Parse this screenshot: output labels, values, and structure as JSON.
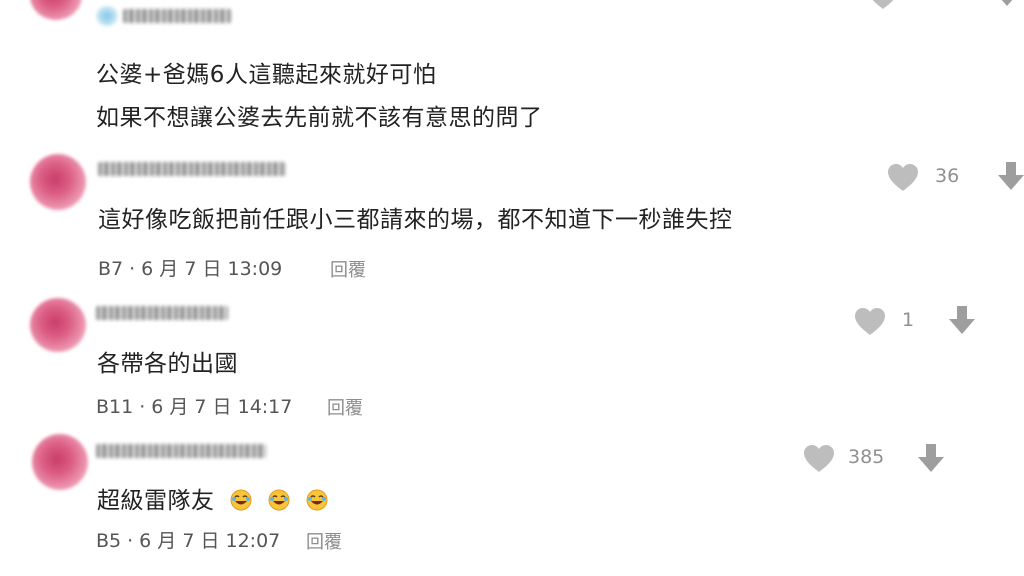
{
  "comments": [
    {
      "lines": [
        "公婆+爸媽6人這聽起來就好可怕",
        "如果不想讓公婆去先前就不該有意思的問了"
      ]
    },
    {
      "text": "這好像吃飯把前任跟小三都請來的場，都不知道下一秒誰失控",
      "floor": "B7",
      "date": "6 月 7 日 13:09",
      "reply_label": "回覆",
      "likes": "36"
    },
    {
      "text": "各帶各的出國",
      "floor": "B11",
      "date": "6 月 7 日 14:17",
      "reply_label": "回覆",
      "likes": "1"
    },
    {
      "text": "超級雷隊友",
      "emojis": [
        "laughing-face-emoji",
        "laughing-face-emoji",
        "laughing-face-emoji"
      ],
      "floor": "B5",
      "date": "6 月 7 日 12:07",
      "reply_label": "回覆",
      "likes": "385"
    }
  ],
  "meta_separator": "·",
  "colors": {
    "icon_gray": "#bdbdbd",
    "icon_dark": "#9e9e9e",
    "text": "#222222",
    "meta": "#555555"
  }
}
